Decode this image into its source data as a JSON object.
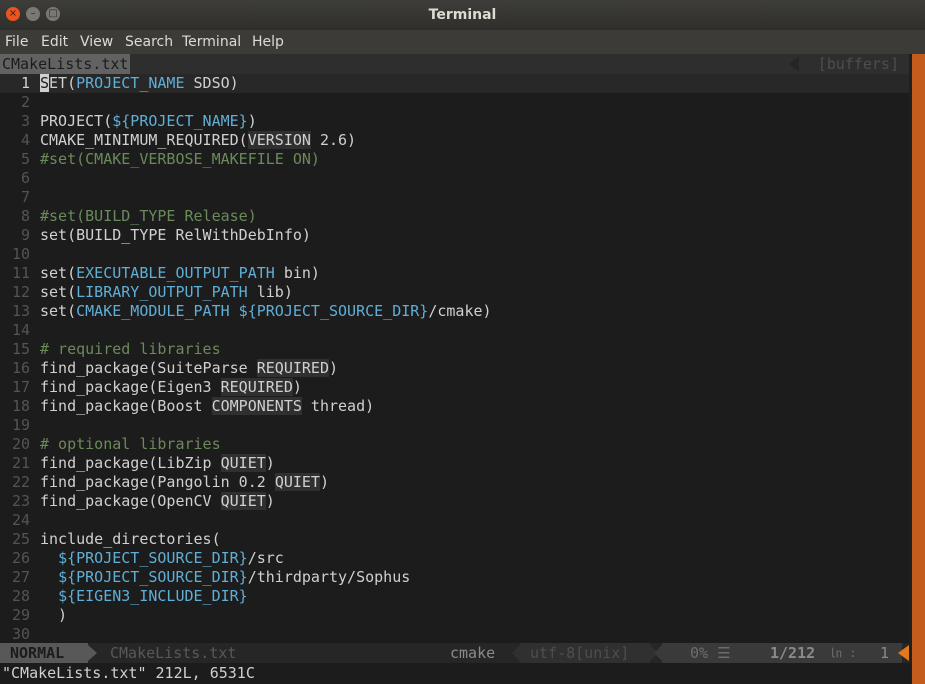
{
  "window": {
    "title": "Terminal",
    "buttons": {
      "close": "×",
      "minimize": "–",
      "maximize": "□"
    }
  },
  "menu": [
    "File",
    "Edit",
    "View",
    "Search",
    "Terminal",
    "Help"
  ],
  "tabline": {
    "active_tab": "CMakeLists.txt",
    "buffers_label": "[buffers]"
  },
  "editor": {
    "lines": [
      {
        "n": "1",
        "segs": [
          [
            "c",
            "S"
          ],
          [
            "kw",
            "ET("
          ],
          [
            "var",
            "PROJECT_NAME"
          ],
          [
            "plain",
            " SDSO)"
          ]
        ],
        "current": true
      },
      {
        "n": "2",
        "segs": []
      },
      {
        "n": "3",
        "segs": [
          [
            "kw",
            "PROJECT("
          ],
          [
            "var",
            "${PROJECT_NAME}"
          ],
          [
            "plain",
            ")"
          ]
        ]
      },
      {
        "n": "4",
        "segs": [
          [
            "kw",
            "CMAKE_MINIMUM_REQUIRED("
          ],
          [
            "hl",
            "VERSION"
          ],
          [
            "plain",
            " 2.6)"
          ]
        ]
      },
      {
        "n": "5",
        "segs": [
          [
            "com",
            "#set(CMAKE_VERBOSE_MAKEFILE ON)"
          ]
        ]
      },
      {
        "n": "6",
        "segs": []
      },
      {
        "n": "7",
        "segs": []
      },
      {
        "n": "8",
        "segs": [
          [
            "com",
            "#set(BUILD_TYPE Release)"
          ]
        ]
      },
      {
        "n": "9",
        "segs": [
          [
            "kw",
            "set(BUILD_TYPE RelWithDebInfo)"
          ]
        ]
      },
      {
        "n": "10",
        "segs": []
      },
      {
        "n": "11",
        "segs": [
          [
            "kw",
            "set("
          ],
          [
            "var",
            "EXECUTABLE_OUTPUT_PATH"
          ],
          [
            "plain",
            " bin)"
          ]
        ]
      },
      {
        "n": "12",
        "segs": [
          [
            "kw",
            "set("
          ],
          [
            "var",
            "LIBRARY_OUTPUT_PATH"
          ],
          [
            "plain",
            " lib)"
          ]
        ]
      },
      {
        "n": "13",
        "segs": [
          [
            "kw",
            "set("
          ],
          [
            "var",
            "CMAKE_MODULE_PATH ${PROJECT_SOURCE_DIR}"
          ],
          [
            "plain",
            "/cmake)"
          ]
        ]
      },
      {
        "n": "14",
        "segs": []
      },
      {
        "n": "15",
        "segs": [
          [
            "com",
            "# required libraries"
          ]
        ]
      },
      {
        "n": "16",
        "segs": [
          [
            "kw",
            "find_package(SuiteParse "
          ],
          [
            "hl",
            "REQUIRED"
          ],
          [
            "plain",
            ")"
          ]
        ]
      },
      {
        "n": "17",
        "segs": [
          [
            "kw",
            "find_package(Eigen3 "
          ],
          [
            "hl",
            "REQUIRED"
          ],
          [
            "plain",
            ")"
          ]
        ]
      },
      {
        "n": "18",
        "segs": [
          [
            "kw",
            "find_package(Boost "
          ],
          [
            "hl",
            "COMPONENTS"
          ],
          [
            "plain",
            " thread)"
          ]
        ]
      },
      {
        "n": "19",
        "segs": []
      },
      {
        "n": "20",
        "segs": [
          [
            "com",
            "# optional libraries"
          ]
        ]
      },
      {
        "n": "21",
        "segs": [
          [
            "kw",
            "find_package(LibZip "
          ],
          [
            "hl",
            "QUIET"
          ],
          [
            "plain",
            ")"
          ]
        ]
      },
      {
        "n": "22",
        "segs": [
          [
            "kw",
            "find_package(Pangolin 0.2 "
          ],
          [
            "hl",
            "QUIET"
          ],
          [
            "plain",
            ")"
          ]
        ]
      },
      {
        "n": "23",
        "segs": [
          [
            "kw",
            "find_package(OpenCV "
          ],
          [
            "hl",
            "QUIET"
          ],
          [
            "plain",
            ")"
          ]
        ]
      },
      {
        "n": "24",
        "segs": []
      },
      {
        "n": "25",
        "segs": [
          [
            "kw",
            "include_directories("
          ]
        ]
      },
      {
        "n": "26",
        "segs": [
          [
            "plain",
            "  "
          ],
          [
            "var",
            "${PROJECT_SOURCE_DIR}"
          ],
          [
            "plain",
            "/src"
          ]
        ]
      },
      {
        "n": "27",
        "segs": [
          [
            "plain",
            "  "
          ],
          [
            "var",
            "${PROJECT_SOURCE_DIR}"
          ],
          [
            "plain",
            "/thirdparty/Sophus"
          ]
        ]
      },
      {
        "n": "28",
        "segs": [
          [
            "plain",
            "  "
          ],
          [
            "var",
            "${EIGEN3_INCLUDE_DIR}"
          ]
        ]
      },
      {
        "n": "29",
        "segs": [
          [
            "plain",
            "  )"
          ]
        ]
      },
      {
        "n": "30",
        "segs": []
      }
    ]
  },
  "statusline": {
    "mode": "NORMAL",
    "filename": "CMakeLists.txt",
    "filetype": "cmake",
    "encoding": "utf-8[unix]",
    "percent": "0% ☰",
    "position": "1/212",
    "line_symbol": "㏑ :",
    "column": "1"
  },
  "cmdline": "\"CMakeLists.txt\" 212L, 6531C",
  "colors": {
    "accent": "#e95420",
    "variable": "#5fafd7",
    "comment": "#6a8a5a"
  }
}
